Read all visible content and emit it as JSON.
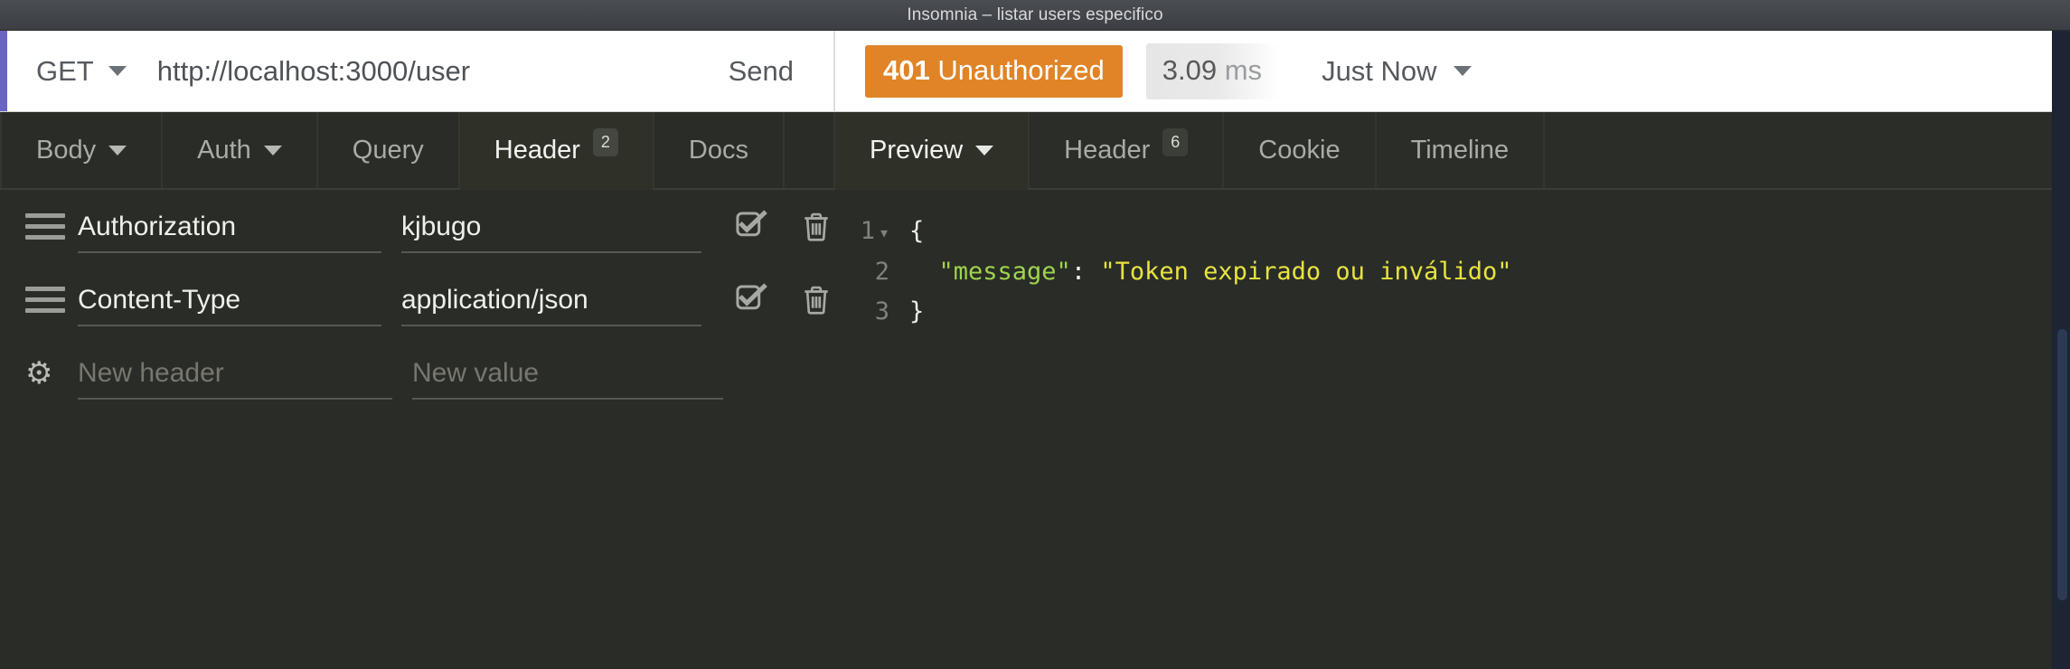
{
  "window": {
    "title": "Insomnia – listar users especifico"
  },
  "request": {
    "method": "GET",
    "url": "http://localhost:3000/user",
    "send_label": "Send",
    "tabs": [
      {
        "label": "Body",
        "has_caret": true,
        "badge": "",
        "active": false
      },
      {
        "label": "Auth",
        "has_caret": true,
        "badge": "",
        "active": false
      },
      {
        "label": "Query",
        "has_caret": false,
        "badge": "",
        "active": false
      },
      {
        "label": "Header",
        "has_caret": false,
        "badge": "2",
        "active": true
      },
      {
        "label": "Docs",
        "has_caret": false,
        "badge": "",
        "active": false
      }
    ],
    "headers": [
      {
        "name": "Authorization",
        "value": "kjbugo",
        "enabled": true
      },
      {
        "name": "Content-Type",
        "value": "application/json",
        "enabled": true
      }
    ],
    "new_row": {
      "name_placeholder": "New header",
      "value_placeholder": "New value"
    }
  },
  "response": {
    "status_code": "401",
    "status_text": "Unauthorized",
    "time_value": "3.09",
    "time_unit": "ms",
    "timestamp": "Just Now",
    "tabs": [
      {
        "label": "Preview",
        "has_caret": true,
        "badge": "",
        "active": true
      },
      {
        "label": "Header",
        "has_caret": false,
        "badge": "6",
        "active": false
      },
      {
        "label": "Cookie",
        "has_caret": false,
        "badge": "",
        "active": false
      },
      {
        "label": "Timeline",
        "has_caret": false,
        "badge": "",
        "active": false
      }
    ],
    "body_lines": [
      {
        "num": "1",
        "foldable": true,
        "open_brace": "{"
      },
      {
        "num": "2",
        "foldable": false,
        "key": "\"message\"",
        "colon": ": ",
        "value": "\"Token expirado ou inválido\""
      },
      {
        "num": "3",
        "foldable": false,
        "close_brace": "}"
      }
    ]
  },
  "colors": {
    "status_badge": "#e08427",
    "accent_bar": "#6a65c0",
    "json_key": "#9fd44d",
    "json_string": "#e7e341",
    "panel_bg": "#2a2c27"
  }
}
